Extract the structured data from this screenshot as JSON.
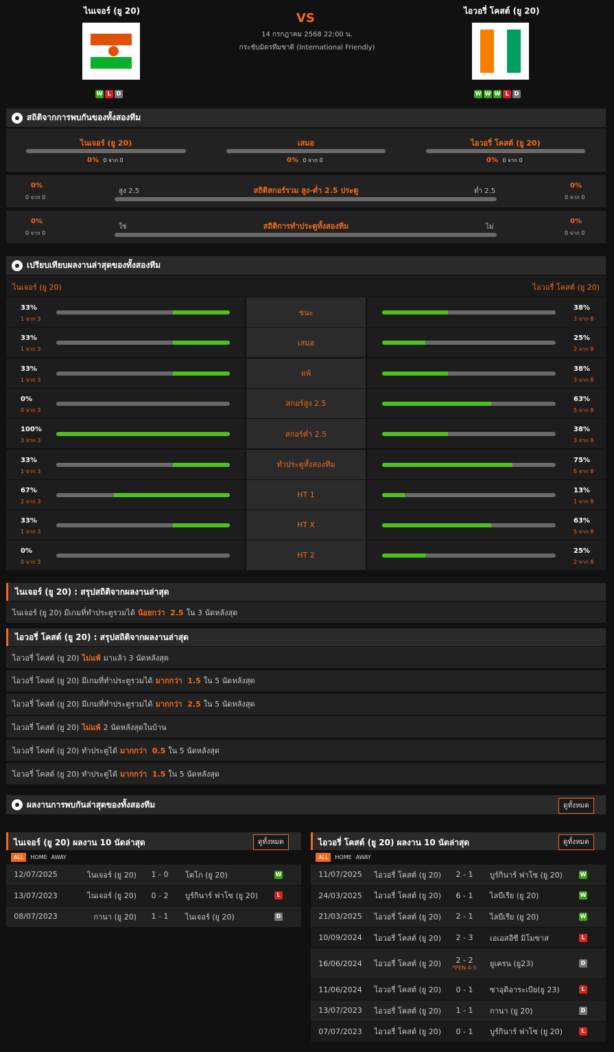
{
  "header": {
    "home": "ไนเจอร์ (ยู 20)",
    "away": "ไอวอรี่ โคสต์ (ยู 20)",
    "vs": "VS",
    "datetime": "14 กรกฎาคม 2568 22:00 น.",
    "competition": "กระชับมิตรทีมชาติ (International Friendly)",
    "home_form": [
      "W",
      "L",
      "D"
    ],
    "away_form": [
      "W",
      "W",
      "W",
      "L",
      "D"
    ]
  },
  "h2h": {
    "title": "สถิติจากการพบกันของทั้งสองทีม",
    "home": "ไนเจอร์ (ยู 20)",
    "draw": "เสมอ",
    "away": "ไอวอรี่ โคสต์ (ยู 20)",
    "home_pct": "0%",
    "home_of": "0 จาก 0",
    "draw_pct": "0%",
    "draw_of": "0 จาก 0",
    "away_pct": "0%",
    "away_of": "0 จาก 0",
    "ou_title": "สถิติสกอร์รวม สูง-ต่ำ 2.5 ประตู",
    "ou_left": "สูง 2.5",
    "ou_right": "ต่ำ 2.5",
    "ou_lpct": "0%",
    "ou_lof": "0 จาก 0",
    "ou_rpct": "0%",
    "ou_rof": "0 จาก 0",
    "btts_title": "สถิติการทำประตูทั้งสองทีม",
    "btts_left": "ใช่",
    "btts_right": "ไม่",
    "btts_lpct": "0%",
    "btts_lof": "0 จาก 0",
    "btts_rpct": "0%",
    "btts_rof": "0 จาก 0"
  },
  "compare": {
    "title": "เปรียบเทียบผลงานล่าสุดของทั้งสองทีม",
    "home": "ไนเจอร์ (ยู 20)",
    "away": "ไอวอรี่ โคสต์ (ยู 20)",
    "rows": [
      {
        "label": "ชนะ",
        "hp": "33%",
        "hs": "1 จาก 3",
        "hv": 0.33,
        "ap": "38%",
        "as": "3 จาก 8",
        "av": 0.38
      },
      {
        "label": "เสมอ",
        "hp": "33%",
        "hs": "1 จาก 3",
        "hv": 0.33,
        "ap": "25%",
        "as": "2 จาก 8",
        "av": 0.25
      },
      {
        "label": "แพ้",
        "hp": "33%",
        "hs": "1 จาก 3",
        "hv": 0.33,
        "ap": "38%",
        "as": "3 จาก 8",
        "av": 0.38
      },
      {
        "label": "สกอร์สูง 2.5",
        "hp": "0%",
        "hs": "0 จาก 3",
        "hv": 0,
        "ap": "63%",
        "as": "5 จาก 8",
        "av": 0.63
      },
      {
        "label": "สกอร์ต่ำ 2.5",
        "hp": "100%",
        "hs": "3 จาก 3",
        "hv": 1,
        "ap": "38%",
        "as": "3 จาก 8",
        "av": 0.38
      },
      {
        "label": "ทำประตูทั้งสองทีม",
        "hp": "33%",
        "hs": "1 จาก 3",
        "hv": 0.33,
        "ap": "75%",
        "as": "6 จาก 8",
        "av": 0.75
      },
      {
        "label": "HT 1",
        "hp": "67%",
        "hs": "2 จาก 3",
        "hv": 0.67,
        "ap": "13%",
        "as": "1 จาก 8",
        "av": 0.13
      },
      {
        "label": "HT X",
        "hp": "33%",
        "hs": "1 จาก 3",
        "hv": 0.33,
        "ap": "63%",
        "as": "5 จาก 8",
        "av": 0.63
      },
      {
        "label": "HT 2",
        "hp": "0%",
        "hs": "0 จาก 3",
        "hv": 0,
        "ap": "25%",
        "as": "2 จาก 8",
        "av": 0.25
      }
    ]
  },
  "summary_home": {
    "title": "ไนเจอร์ (ยู 20) : สรุปสถิติจากผลงานล่าสุด",
    "rows": [
      {
        "a": "ไนเจอร์ (ยู 20) มีเกมที่ทำประตูรวมได้",
        "b": "น้อยกว่า  2.5",
        "c": "ใน 3 นัดหลังสุด"
      }
    ]
  },
  "summary_away": {
    "title": "ไอวอรี่ โคสต์ (ยู 20) : สรุปสถิติจากผลงานล่าสุด",
    "rows": [
      {
        "a": "ไอวอรี่ โคสต์ (ยู 20)",
        "b": "ไม่แพ้",
        "c": "มาแล้ว 3 นัดหลังสุด"
      },
      {
        "a": "ไอวอรี่ โคสต์ (ยู 20) มีเกมที่ทำประตูรวมได้",
        "b": "มากกว่า  1.5",
        "c": "ใน 5 นัดหลังสุด"
      },
      {
        "a": "ไอวอรี่ โคสต์ (ยู 20) มีเกมที่ทำประตูรวมได้",
        "b": "มากกว่า  2.5",
        "c": "ใน 5 นัดหลังสุด"
      },
      {
        "a": "ไอวอรี่ โคสต์ (ยู 20)",
        "b": "ไม่แพ้",
        "c": "2  นัดหลังสุดในบ้าน"
      },
      {
        "a": "ไอวอรี่ โคสต์ (ยู 20) ทำประตูได้",
        "b": "มากกว่า  0.5",
        "c": "ใน 5 นัดหลังสุด"
      },
      {
        "a": "ไอวอรี่ โคสต์ (ยู 20) ทำประตูได้",
        "b": "มากกว่า  1.5",
        "c": "ใน 5 นัดหลังสุด"
      }
    ]
  },
  "recent": {
    "title": "ผลงานการพบกันล่าสุดของทั้งสองทีม",
    "view_all": "ดูทั้งหมด",
    "tab_all": "ALL",
    "tab_home": "HOME",
    "tab_away": "AWAY",
    "home_title": "ไนเจอร์ (ยู 20) ผลงาน 10 นัดล่าสุด",
    "away_title": "ไอวอรี่ โคสต์ (ยู 20) ผลงาน 10 นัดล่าสุด",
    "home_matches": [
      {
        "date": "12/07/2025",
        "h": "ไนเจอร์ (ยู 20)",
        "s": "1 - 0",
        "a": "โตโก (ยู 20)",
        "r": "W"
      },
      {
        "date": "13/07/2023",
        "h": "ไนเจอร์ (ยู 20)",
        "s": "0 - 2",
        "a": "บูร์กินาร์ ฟาโซ (ยู 20)",
        "r": "L"
      },
      {
        "date": "08/07/2023",
        "h": "กานา (ยู 20)",
        "s": "1 - 1",
        "a": "ไนเจอร์ (ยู 20)",
        "r": "D"
      }
    ],
    "away_matches": [
      {
        "date": "11/07/2025",
        "h": "ไอวอรี่ โคสต์ (ยู 20)",
        "s": "2 - 1",
        "a": "บูร์กินาร์ ฟาโซ (ยู 20)",
        "r": "W",
        "pen": ""
      },
      {
        "date": "24/03/2025",
        "h": "ไอวอรี่ โคสต์ (ยู 20)",
        "s": "6 - 1",
        "a": "ไลบีเรีย (ยู 20)",
        "r": "W",
        "pen": ""
      },
      {
        "date": "21/03/2025",
        "h": "ไอวอรี่ โคสต์ (ยู 20)",
        "s": "2 - 1",
        "a": "ไลบีเรีย (ยู 20)",
        "r": "W",
        "pen": ""
      },
      {
        "date": "10/09/2024",
        "h": "ไอวอรี่ โคสต์ (ยู 20)",
        "s": "2 - 3",
        "a": "เอเอสอีซี มิโมซาส",
        "r": "L",
        "pen": ""
      },
      {
        "date": "16/06/2024",
        "h": "ไอวอรี่ โคสต์ (ยู 20)",
        "s": "2 - 2",
        "a": "ยูเครน (ยู23)",
        "r": "D",
        "pen": "*PEN 4-5"
      },
      {
        "date": "11/06/2024",
        "h": "ไอวอรี่ โคสต์ (ยู 20)",
        "s": "0 - 1",
        "a": "ซาอุดิอาระเบีย(ยู 23)",
        "r": "L",
        "pen": ""
      },
      {
        "date": "13/07/2023",
        "h": "ไอวอรี่ โคสต์ (ยู 20)",
        "s": "1 - 1",
        "a": "กานา (ยู 20)",
        "r": "D",
        "pen": ""
      },
      {
        "date": "07/07/2023",
        "h": "ไอวอรี่ โคสต์ (ยู 20)",
        "s": "0 - 1",
        "a": "บูร์กินาร์ ฟาโซ (ยู 20)",
        "r": "L",
        "pen": ""
      }
    ]
  },
  "colors": {
    "accent": "#f26b1d",
    "win": "#3aa51c",
    "loss": "#d9231d",
    "draw": "#777777",
    "bar_fill": "#4fc11c"
  }
}
